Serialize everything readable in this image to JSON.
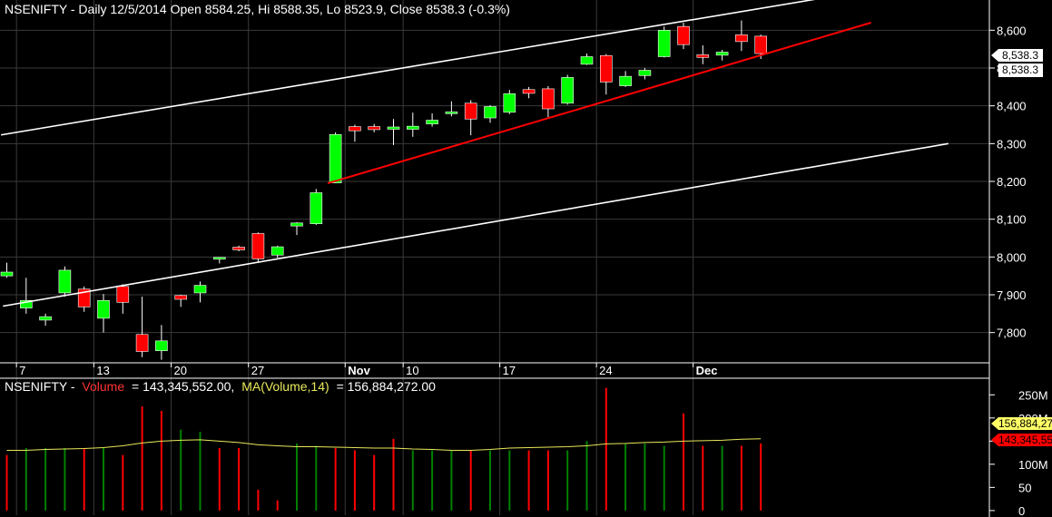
{
  "header": {
    "symbol": "NSENIFTY",
    "text": "NSENIFTY - Daily 12/5/2014 Open 8584.25, Hi 8588.35, Lo 8523.9, Close 8538.3 (-0.3%)"
  },
  "volume_header": {
    "symbol": "NSENIFTY -",
    "volume_label": "Volume",
    "volume_value": "= 143,345,552.00,",
    "ma_label": "MA(Volume,14)",
    "ma_value": "= 156,884,272.00"
  },
  "price_badges": {
    "top": "8,538.3",
    "bottom": "8,538.3"
  },
  "volume_badges": {
    "ma": "156,884,272",
    "vol": "143,345,552"
  },
  "colors": {
    "up": "#00ff00",
    "down": "#ff0000",
    "white": "#ffffff",
    "trend_red": "#ff0000",
    "ma_line": "#e8e85a",
    "vol_up": "#008000",
    "vol_down": "#ff0000",
    "grid": "#3a3a3a"
  },
  "chart_data": [
    {
      "type": "candlestick",
      "title": "NSENIFTY - Daily 12/5/2014",
      "ylim": [
        7720,
        8680
      ],
      "y_ticks": [
        7800,
        7900,
        8000,
        8100,
        8200,
        8300,
        8400,
        8500,
        8600
      ],
      "y_tick_labels": [
        "7,800",
        "7,900",
        "8,000",
        "8,100",
        "8,200",
        "8,300",
        "8,400",
        "8,500",
        "8,600"
      ],
      "x_labels": [
        {
          "label": "7",
          "index": 1
        },
        {
          "label": "13",
          "index": 5
        },
        {
          "label": "20",
          "index": 9
        },
        {
          "label": "27",
          "index": 13
        },
        {
          "label": "Nov",
          "index": 18
        },
        {
          "label": "10",
          "index": 21
        },
        {
          "label": "17",
          "index": 26
        },
        {
          "label": "24",
          "index": 31
        },
        {
          "label": "Dec",
          "index": 36
        }
      ],
      "candles": [
        {
          "o": 7950,
          "h": 7985,
          "l": 7945,
          "c": 7960
        },
        {
          "o": 7865,
          "h": 7945,
          "l": 7850,
          "c": 7885
        },
        {
          "o": 7833,
          "h": 7850,
          "l": 7818,
          "c": 7842
        },
        {
          "o": 7905,
          "h": 7975,
          "l": 7895,
          "c": 7965
        },
        {
          "o": 7915,
          "h": 7922,
          "l": 7855,
          "c": 7868
        },
        {
          "o": 7838,
          "h": 7902,
          "l": 7800,
          "c": 7885
        },
        {
          "o": 7922,
          "h": 7928,
          "l": 7850,
          "c": 7880
        },
        {
          "o": 7795,
          "h": 7895,
          "l": 7735,
          "c": 7750
        },
        {
          "o": 7752,
          "h": 7820,
          "l": 7728,
          "c": 7778
        },
        {
          "o": 7898,
          "h": 7900,
          "l": 7868,
          "c": 7888
        },
        {
          "o": 7905,
          "h": 7935,
          "l": 7880,
          "c": 7925
        },
        {
          "o": 7997,
          "h": 8000,
          "l": 7983,
          "c": 7999
        },
        {
          "o": 8026,
          "h": 8030,
          "l": 8015,
          "c": 8019
        },
        {
          "o": 8062,
          "h": 8065,
          "l": 7985,
          "c": 7995
        },
        {
          "o": 8005,
          "h": 8030,
          "l": 7998,
          "c": 8027
        },
        {
          "o": 8082,
          "h": 8092,
          "l": 8058,
          "c": 8090
        },
        {
          "o": 8088,
          "h": 8180,
          "l": 8085,
          "c": 8170
        },
        {
          "o": 8196,
          "h": 8330,
          "l": 8195,
          "c": 8324
        },
        {
          "o": 8345,
          "h": 8350,
          "l": 8305,
          "c": 8334
        },
        {
          "o": 8345,
          "h": 8352,
          "l": 8330,
          "c": 8337
        },
        {
          "o": 8338,
          "h": 8365,
          "l": 8296,
          "c": 8344
        },
        {
          "o": 8338,
          "h": 8382,
          "l": 8318,
          "c": 8346
        },
        {
          "o": 8352,
          "h": 8380,
          "l": 8345,
          "c": 8362
        },
        {
          "o": 8380,
          "h": 8412,
          "l": 8372,
          "c": 8384
        },
        {
          "o": 8407,
          "h": 8415,
          "l": 8322,
          "c": 8365
        },
        {
          "o": 8368,
          "h": 8402,
          "l": 8355,
          "c": 8398
        },
        {
          "o": 8383,
          "h": 8442,
          "l": 8378,
          "c": 8432
        },
        {
          "o": 8443,
          "h": 8450,
          "l": 8420,
          "c": 8433
        },
        {
          "o": 8445,
          "h": 8452,
          "l": 8370,
          "c": 8392
        },
        {
          "o": 8407,
          "h": 8482,
          "l": 8403,
          "c": 8475
        },
        {
          "o": 8510,
          "h": 8538,
          "l": 8508,
          "c": 8530
        },
        {
          "o": 8533,
          "h": 8537,
          "l": 8430,
          "c": 8463
        },
        {
          "o": 8453,
          "h": 8492,
          "l": 8450,
          "c": 8478
        },
        {
          "o": 8480,
          "h": 8500,
          "l": 8470,
          "c": 8494
        },
        {
          "o": 8530,
          "h": 8610,
          "l": 8528,
          "c": 8600
        },
        {
          "o": 8610,
          "h": 8620,
          "l": 8550,
          "c": 8562
        },
        {
          "o": 8535,
          "h": 8560,
          "l": 8510,
          "c": 8528
        },
        {
          "o": 8534,
          "h": 8548,
          "l": 8520,
          "c": 8542
        },
        {
          "o": 8588,
          "h": 8626,
          "l": 8545,
          "c": 8570
        },
        {
          "o": 8584.25,
          "h": 8588.35,
          "l": 8523.9,
          "c": 8538.3
        }
      ],
      "trendlines": [
        {
          "color": "white",
          "from": {
            "index": -0.3,
            "value": 8323
          },
          "to": {
            "index": 43,
            "value": 8692
          }
        },
        {
          "color": "white",
          "from": {
            "index": -0.2,
            "value": 7870
          },
          "to": {
            "index": 48.7,
            "value": 8300
          }
        },
        {
          "color": "red",
          "from": {
            "index": 16.6,
            "value": 8195
          },
          "to": {
            "index": 44.7,
            "value": 8620
          }
        }
      ]
    },
    {
      "type": "bar",
      "title": "Volume",
      "ylim": [
        -10,
        280
      ],
      "y_ticks": [
        0,
        50,
        100,
        150,
        200,
        250
      ],
      "y_tick_labels": [
        "0",
        "50",
        "100M",
        "150M",
        "200M",
        "250M"
      ],
      "volume_millions": [
        120,
        135,
        135,
        135,
        135,
        135,
        120,
        225,
        215,
        175,
        170,
        135,
        135,
        45,
        22,
        145,
        140,
        135,
        130,
        120,
        155,
        130,
        130,
        130,
        130,
        130,
        130,
        130,
        130,
        130,
        150,
        265,
        145,
        145,
        140,
        210,
        140,
        140,
        140,
        145
      ],
      "volume_up": [
        false,
        true,
        true,
        true,
        false,
        true,
        false,
        false,
        false,
        true,
        true,
        false,
        false,
        false,
        false,
        true,
        true,
        false,
        false,
        false,
        false,
        true,
        true,
        true,
        false,
        true,
        true,
        false,
        false,
        true,
        true,
        false,
        true,
        true,
        true,
        false,
        false,
        true,
        false,
        false
      ],
      "ma14_millions": [
        130,
        130,
        132,
        133,
        134,
        136,
        140,
        146,
        150,
        152,
        153,
        150,
        147,
        142,
        140,
        138,
        138,
        137,
        136,
        135,
        135,
        133,
        132,
        130,
        130,
        132,
        135,
        136,
        137,
        138,
        140,
        144,
        145,
        147,
        148,
        150,
        151,
        152,
        154,
        155
      ]
    }
  ]
}
